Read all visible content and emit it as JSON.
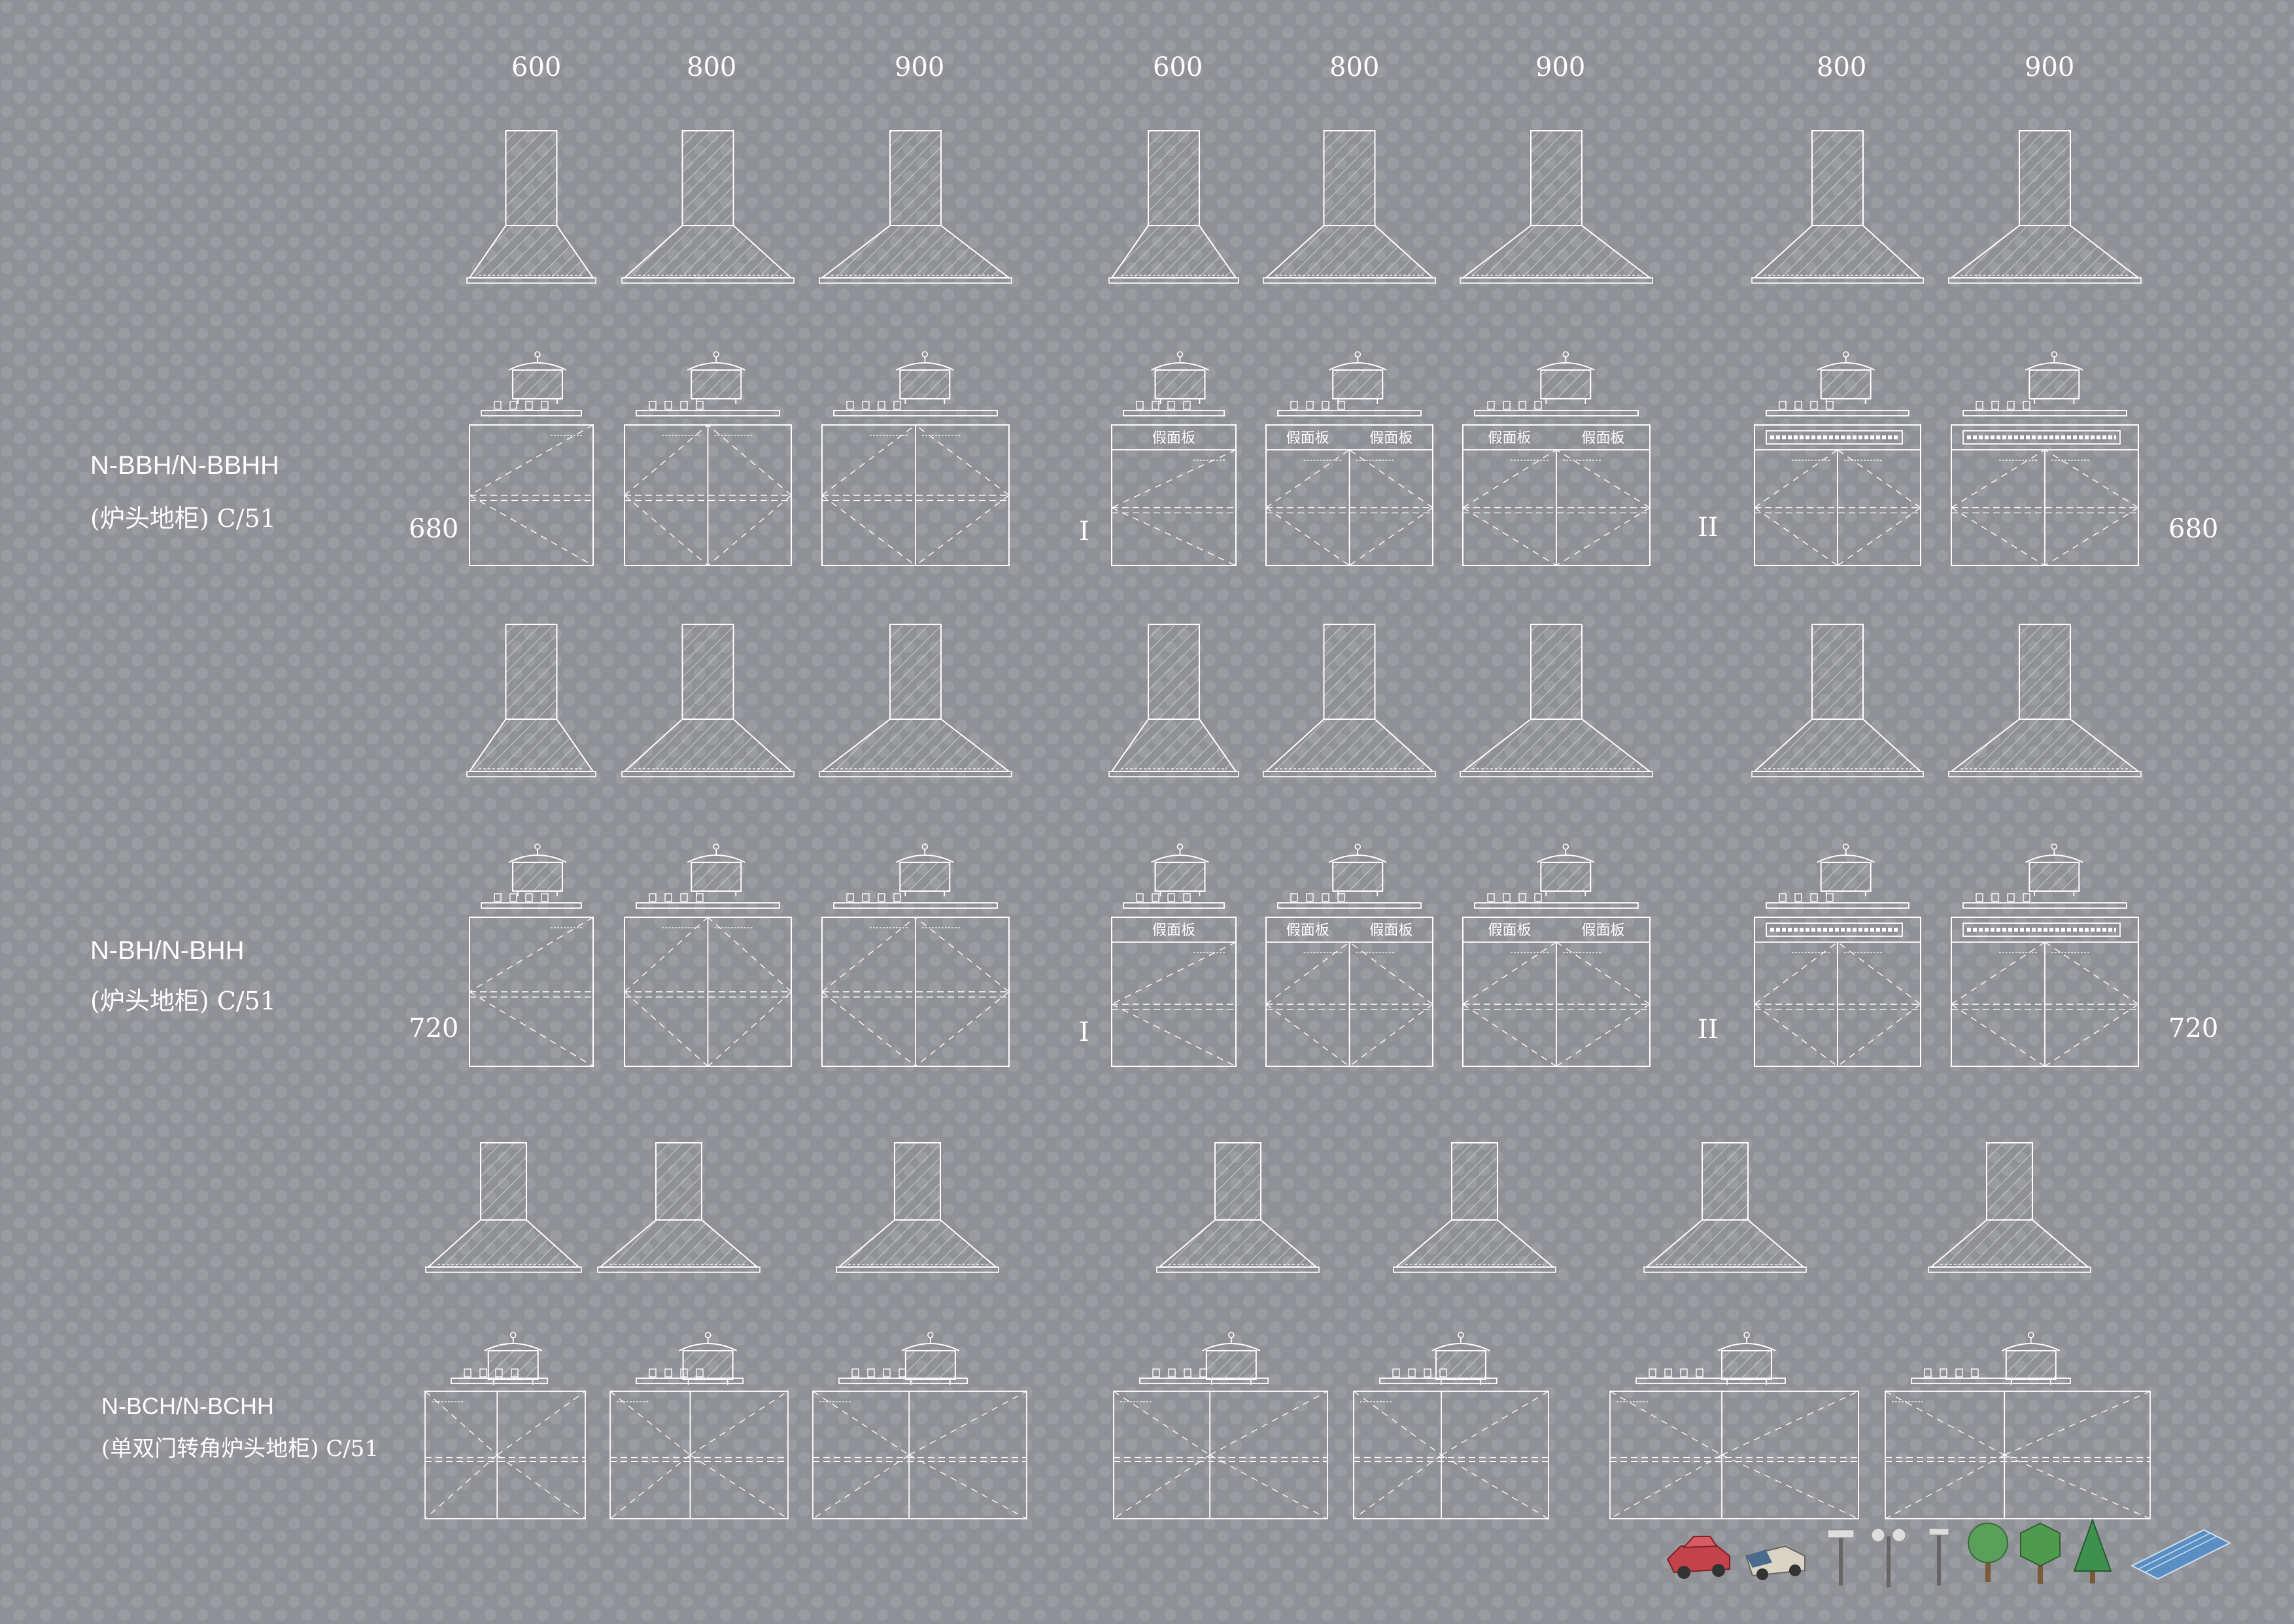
{
  "column_widths": {
    "top": [
      "600",
      "800",
      "900",
      "600",
      "800",
      "900",
      "800",
      "900"
    ]
  },
  "rows": [
    {
      "name": "N-BBH/N-BBHH",
      "desc": "(炉头地柜) C/51",
      "height_left": "680",
      "height_right": "680"
    },
    {
      "name": "N-BH/N-BHH",
      "desc": "(炉头地柜) C/51",
      "height_left": "720",
      "height_right": "720"
    },
    {
      "name": "N-BCH/N-BCHH",
      "desc": "(单双门转角炉头地柜) C/51"
    }
  ],
  "group_markers": {
    "first": "I",
    "second": "II"
  },
  "panel_text": "假面板",
  "colors": {
    "background": "#8f9196",
    "line": "#ffffff",
    "dots": "#9a9ca1"
  },
  "icons": [
    "car-red-icon",
    "truck-icon",
    "street-lamp-icon",
    "street-lamp-double-icon",
    "street-lamp-icon",
    "round-tree-icon",
    "cube-tree-icon",
    "conifer-tree-icon",
    "solar-panel-icon"
  ]
}
